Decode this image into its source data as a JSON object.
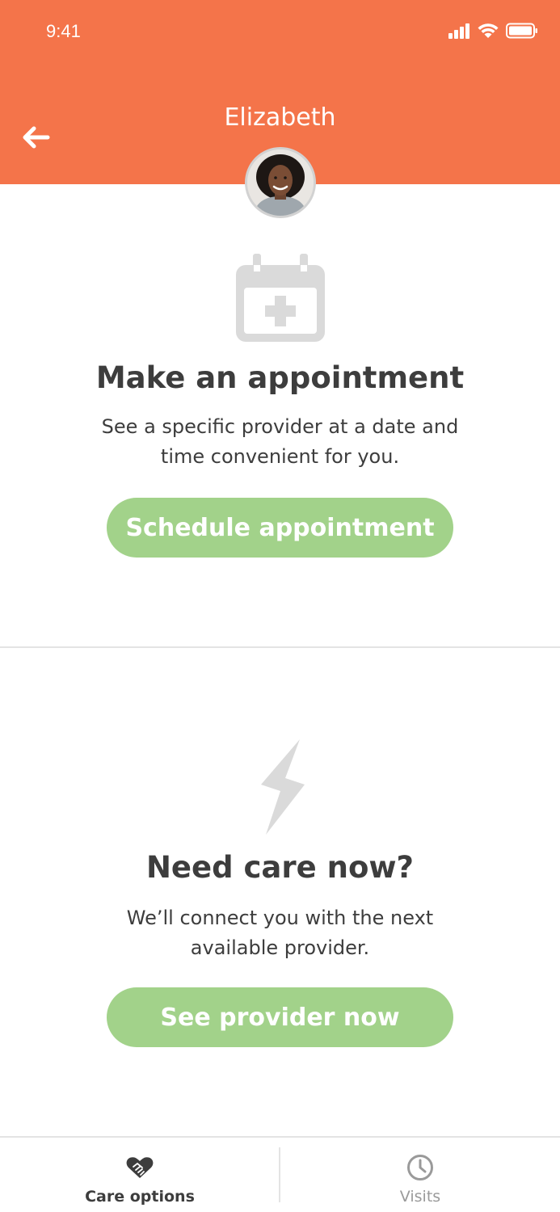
{
  "status_bar": {
    "time": "9:41"
  },
  "header": {
    "title": "Elizabeth",
    "background_color": "#f4744a",
    "back_icon": "arrow-left-icon"
  },
  "appointment_section": {
    "icon": "calendar-plus-icon",
    "title": "Make an appointment",
    "description": "See a specific provider at a date and time convenient for you.",
    "button_label": "Schedule appointment"
  },
  "care_now_section": {
    "icon": "lightning-bolt-icon",
    "title": "Need care now?",
    "description": "We’ll connect you with the next available provider.",
    "button_label": "See provider now"
  },
  "tabbar": {
    "tabs": [
      {
        "label": "Care options",
        "icon": "heart-handshake-icon",
        "active": true
      },
      {
        "label": "Visits",
        "icon": "clock-icon",
        "active": false
      }
    ]
  },
  "colors": {
    "accent": "#f4744a",
    "button": "#a2d28a",
    "text": "#3d3d3d",
    "muted_icon": "#dadada"
  }
}
